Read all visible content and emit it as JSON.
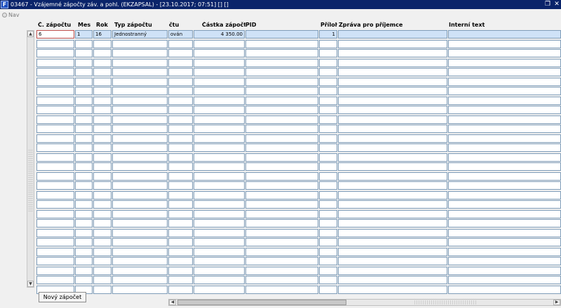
{
  "window": {
    "title": "03467 - Vzájemné zápočty záv. a pohl. (EKZAPSAL) - [23.10.2017; 07:51] [] []",
    "app_icon": "F"
  },
  "nav": {
    "label": "Nav"
  },
  "columns": {
    "c_zapoctu": "Č. zápočtu",
    "mes": "Mes",
    "rok": "Rok",
    "typ_zapoctu": "Typ zápočtu",
    "ctu": "čtu",
    "castka_zapoctu": "Částka zápočtu",
    "pid": "PID",
    "priloh": "Příloh",
    "zprava": "Zpráva pro příjemce",
    "interni_text": "Interní text"
  },
  "rows": [
    {
      "c_zapoctu": "6",
      "mes": "1",
      "rok": "16",
      "typ_zapoctu": "Jednostranný",
      "ctu": "ován",
      "castka": "4 350.00",
      "pid": "",
      "priloh": "1",
      "zprava": "",
      "interni": ""
    }
  ],
  "empty_row_count": 27,
  "buttons": {
    "novy_zapocet": "Nový zápočet"
  },
  "colors": {
    "titlebar": "#0a246a",
    "selected_row": "#cfe2f7",
    "focus_border": "#c0504d",
    "cell_border": "#7f9db9"
  }
}
